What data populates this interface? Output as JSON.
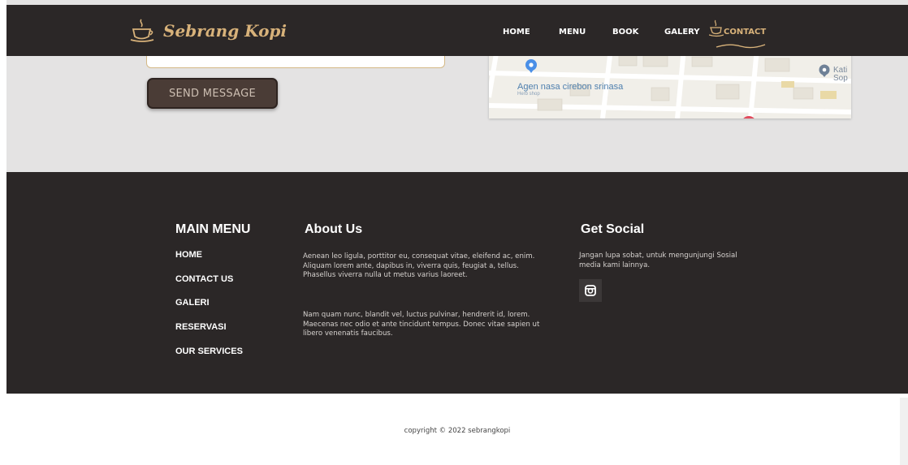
{
  "brand": {
    "name": "Sebrang Kopi"
  },
  "nav": {
    "items": [
      "HOME",
      "MENU",
      "BOOK",
      "GALERY",
      "CONTACT"
    ],
    "active": "CONTACT"
  },
  "contact": {
    "send_label": "SEND MESSAGE",
    "map": {
      "place_label": "Agen nasa cirebon srinasa",
      "place_sub": "Herb shop",
      "side_label": "Kati Sop"
    }
  },
  "footer": {
    "main_menu": {
      "title": "MAIN MENU",
      "items": [
        "HOME",
        "CONTACT US",
        "GALERI",
        "RESERVASI",
        "OUR SERVICES"
      ]
    },
    "about": {
      "title": "About Us",
      "paragraph1": "Aenean leo ligula, porttitor eu, consequat vitae, eleifend ac, enim. Aliquam lorem ante, dapibus in, viverra quis, feugiat a, tellus. Phasellus viverra nulla ut metus varius laoreet.",
      "paragraph2": "Nam quam nunc, blandit vel, luctus pulvinar, hendrerit id, lorem. Maecenas nec odio et ante tincidunt tempus. Donec vitae sapien ut libero venenatis faucibus."
    },
    "social": {
      "title": "Get Social",
      "text": "Jangan lupa sobat, untuk mengunjungi Sosial media kami lainnya.",
      "icon": "instagram-icon"
    }
  },
  "copyright": "copyright © 2022 sebrangkopi",
  "colors": {
    "header_bg": "#2b2727",
    "accent_gold": "#d8b27a",
    "section_gray": "#e4e3e3",
    "button_brown": "#4a3c36"
  }
}
